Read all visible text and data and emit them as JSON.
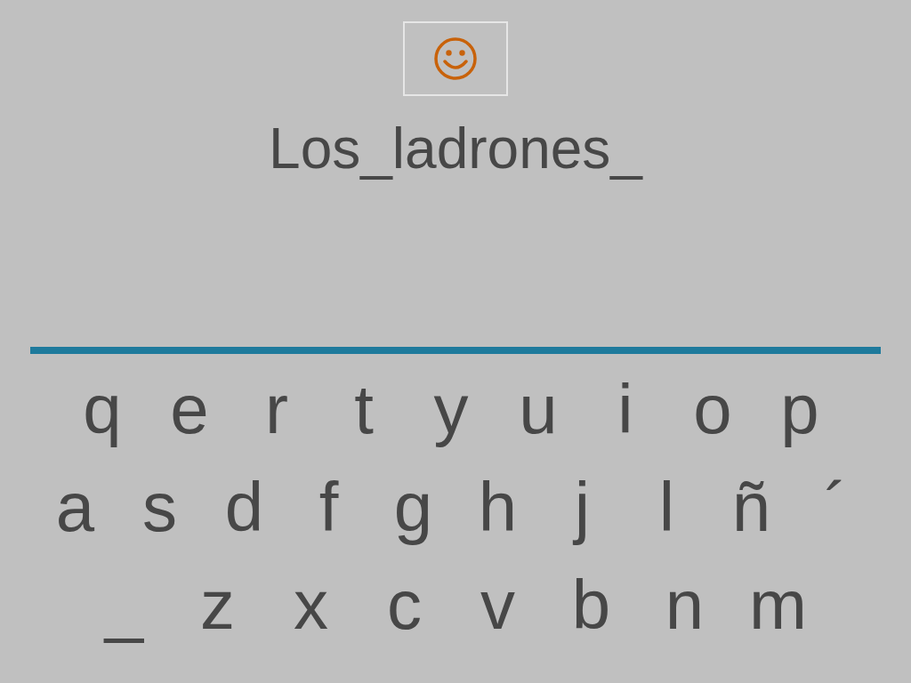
{
  "answer": "Los_ladrones_",
  "keyboard": {
    "rows": [
      [
        "q",
        "e",
        "r",
        "t",
        "y",
        "u",
        "i",
        "o",
        "p"
      ],
      [
        "a",
        "s",
        "d",
        "f",
        "g",
        "h",
        "j",
        "l",
        "ñ",
        "´"
      ],
      [
        "_",
        "z",
        "x",
        "c",
        "v",
        "b",
        "n",
        "m"
      ]
    ]
  }
}
